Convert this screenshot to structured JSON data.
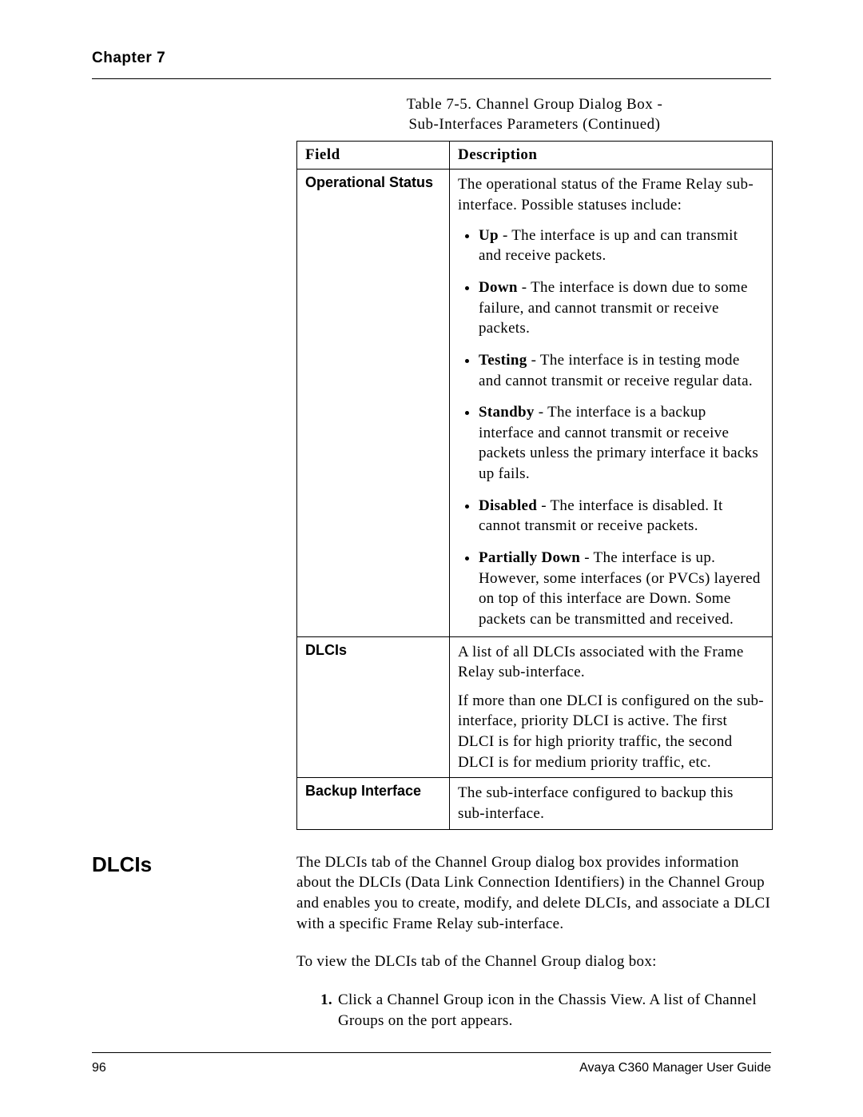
{
  "header": {
    "chapter": "Chapter 7"
  },
  "table": {
    "caption_line1": "Table 7-5. Channel Group Dialog Box -",
    "caption_line2": "Sub-Interfaces Parameters (Continued)",
    "head_field": "Field",
    "head_desc": "Description",
    "rows": [
      {
        "field": "Operational Status",
        "intro": "The operational status of the Frame Relay sub-interface. Possible statuses include:",
        "bullets": [
          {
            "term": "Up",
            "text": " - The interface is up and can transmit and receive packets."
          },
          {
            "term": "Down",
            "text": " - The interface is down due to some failure, and cannot transmit or receive packets."
          },
          {
            "term": "Testing",
            "text": " - The interface is in testing mode and cannot transmit or receive regular data."
          },
          {
            "term": "Standby",
            "text": " - The interface is a backup interface and cannot transmit or receive packets unless the primary interface it backs up fails."
          },
          {
            "term": "Disabled",
            "text": " - The interface is disabled. It cannot transmit or receive packets."
          },
          {
            "term": "Partially Down",
            "text": " - The interface is up. However, some interfaces (or PVCs) layered on top of this interface are Down. Some packets can be transmitted and received."
          }
        ]
      },
      {
        "field": "DLCIs",
        "para1": "A list of all DLCIs associated with the Frame Relay sub-interface.",
        "para2": "If more than one DLCI is configured on the sub-interface, priority DLCI is active. The first DLCI is for high priority traffic, the second DLCI is for medium priority traffic, etc."
      },
      {
        "field": "Backup Interface",
        "para1": "The sub-interface configured to backup this sub-interface."
      }
    ]
  },
  "section": {
    "heading": "DLCIs",
    "para1": "The DLCIs tab of the Channel Group dialog box provides information about the DLCIs (Data Link Connection Identifiers) in the Channel Group and enables you to create, modify, and delete DLCIs, and associate a DLCI with a specific Frame Relay sub-interface.",
    "para2": "To view the DLCIs tab of the Channel Group dialog box:",
    "step1": "Click a Channel Group icon in the Chassis View. A list of Channel Groups on the port appears."
  },
  "footer": {
    "page": "96",
    "guide": "Avaya C360 Manager User Guide"
  }
}
